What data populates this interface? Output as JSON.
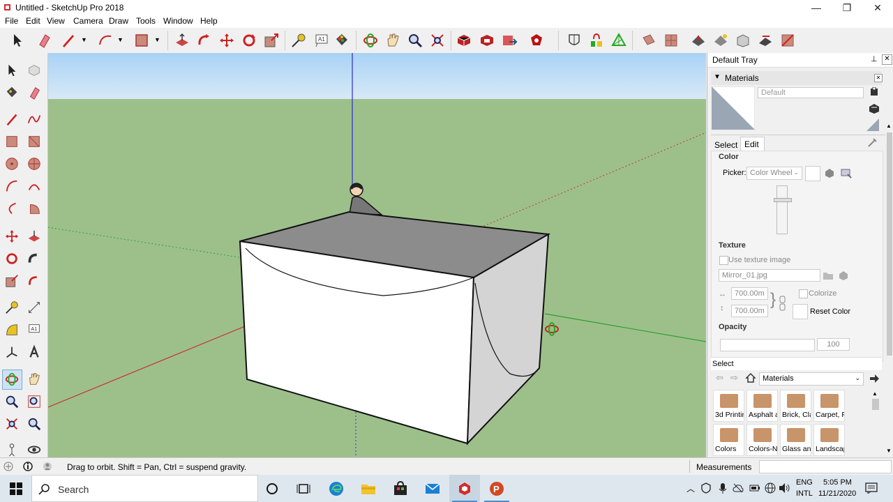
{
  "window": {
    "title": "Untitled - SketchUp Pro 2018",
    "min_glyph": "—",
    "max_glyph": "❐",
    "close_glyph": "✕"
  },
  "menu": [
    "File",
    "Edit",
    "View",
    "Camera",
    "Draw",
    "Tools",
    "Window",
    "Help"
  ],
  "toolbar_icons": [
    "select",
    "eraser",
    "pencil",
    "arc",
    "rectangle",
    "push-pull",
    "follow-me",
    "move",
    "rotate",
    "scale",
    "tape-measure",
    "text",
    "paint-bucket",
    "orbit",
    "pan",
    "zoom",
    "zoom-extents",
    "warehouse",
    "extension-warehouse",
    "send-to-layout",
    "extension-manager",
    "x-ray",
    "materials",
    "styles",
    "section-plane",
    "section-cut",
    "display-section",
    "shadows",
    "fog",
    "match-photo",
    "add-location"
  ],
  "palette_icons": [
    "select",
    "component",
    "paint-bucket",
    "eraser",
    "line",
    "freehand",
    "rectangle",
    "rotated-rectangle",
    "circle",
    "polygon",
    "arc",
    "2-point-arc",
    "3-point-arc",
    "pie",
    "move",
    "push-pull",
    "rotate",
    "follow-me",
    "scale",
    "offset",
    "tape-measure",
    "dimension",
    "protractor",
    "text",
    "axes",
    "3d-text",
    "orbit",
    "pan",
    "zoom",
    "zoom-window",
    "zoom-extents",
    "previous",
    "position-camera",
    "look-around",
    "walk",
    "section-plane"
  ],
  "tray": {
    "title": "Default Tray",
    "pin_glyph": "📌",
    "materials_header": "Materials",
    "material_name": "Default",
    "tab_select": "Select",
    "tab_edit": "Edit",
    "color_label": "Color",
    "picker_label": "Picker:",
    "picker_value": "Color Wheel",
    "texture_label": "Texture",
    "use_texture": "Use texture image",
    "texture_file": "Mirror_01.jpg",
    "width": "700.00m",
    "height": "700.00m",
    "colorize": "Colorize",
    "reset_color": "Reset Color",
    "opacity_label": "Opacity",
    "opacity_value": "100",
    "select_label": "Select",
    "library": "Materials",
    "materials": [
      "3d Printir",
      "Asphalt a",
      "Brick, Cla",
      "Carpet, F",
      "Colors",
      "Colors-N",
      "Glass anc",
      "Landscap"
    ]
  },
  "status": {
    "hint": "Drag to orbit. Shift = Pan, Ctrl = suspend gravity.",
    "measurements_label": "Measurements",
    "measurements_value": ""
  },
  "taskbar": {
    "search": "Search",
    "lang1": "ENG",
    "lang2": "INTL",
    "time": "5:05 PM",
    "date": "11/21/2020"
  },
  "colors": {
    "sky": "#b7d8f5",
    "ground": "#9dc08b",
    "accent": "#c8946a",
    "red_axis": "#cc2b2b",
    "green_axis": "#2ca02c",
    "blue_axis": "#2b2bcc"
  }
}
